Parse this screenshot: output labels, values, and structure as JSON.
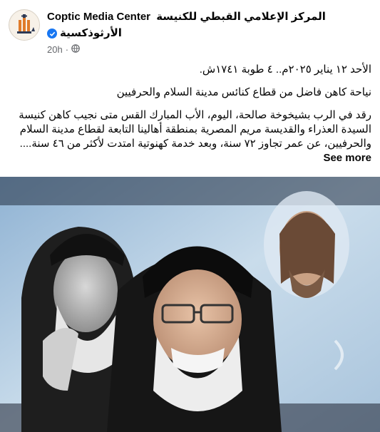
{
  "post": {
    "page_name_en": "Coptic Media Center",
    "page_name_ar_line1": "المركز الإعلامي القبطي للكنيسة",
    "page_name_ar_line2": "الأرثوذكسية",
    "time": "20h",
    "dot": "·",
    "date_line": "الأحد ١٢ يناير ٢٠٢٥م.. ٤ طوبة ١٧٤١ش.",
    "headline": "نياحة كاهن فاضل من قطاع كنائس مدينة السلام والحرفيين",
    "body": "رقد في الرب بشيخوخة صالحة، اليوم، الأب المبارك القس متى نجيب كاهن كنيسة السيدة العذراء والقديسة مريم المصرية بمنطقة أهالينا التابعة لقطاع مدينة السلام والحرفيين، عن عمر تجاوز ٧٢ سنة، وبعد خدمة كهنوتية امتدت لأكثر من ٤٦ سنة....",
    "see_more": "See more"
  },
  "icons": {
    "avatar": "church-logo-icon",
    "verified": "verified-badge-icon",
    "audience": "globe-icon"
  },
  "colors": {
    "verified": "#1877f2",
    "meta_text": "#65676b",
    "text": "#050505"
  }
}
